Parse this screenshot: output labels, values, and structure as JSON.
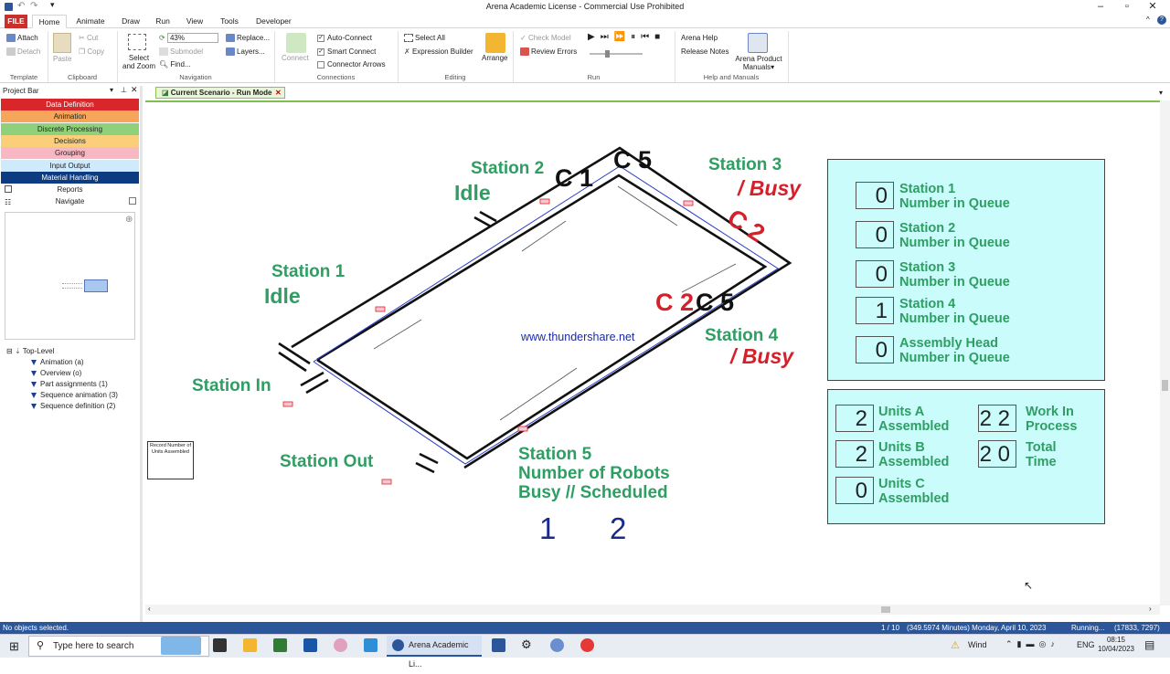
{
  "window": {
    "title": "Arena Academic License - Commercial Use Prohibited"
  },
  "tabs": [
    "FILE",
    "Home",
    "Animate",
    "Draw",
    "Run",
    "View",
    "Tools",
    "Developer"
  ],
  "ribbon": {
    "template": {
      "attach": "Attach",
      "detach": "Detach",
      "label": "Template"
    },
    "clipboard": {
      "paste": "Paste",
      "cut": "Cut",
      "copy": "Copy",
      "label": "Clipboard"
    },
    "navigation": {
      "select_zoom_1": "Select",
      "select_zoom_2": "and Zoom",
      "zoom": "43%",
      "submodel": "Submodel",
      "find": "Find...",
      "replace": "Replace...",
      "layers": "Layers...",
      "label": "Navigation"
    },
    "connections": {
      "connect": "Connect",
      "auto_connect": "Auto-Connect",
      "smart_connect": "Smart Connect",
      "connector_arrows": "Connector Arrows",
      "label": "Connections"
    },
    "editing": {
      "select_all": "Select All",
      "expression_builder": "Expression Builder",
      "arrange": "Arrange",
      "label": "Editing"
    },
    "run": {
      "check_model": "Check Model",
      "review_errors": "Review Errors",
      "label": "Run"
    },
    "help": {
      "arena_help": "Arena Help",
      "release_notes": "Release Notes",
      "product_manuals_1": "Arena Product",
      "product_manuals_2": "Manuals",
      "label": "Help and Manuals"
    }
  },
  "project_bar": {
    "title": "Project Bar",
    "panels": [
      {
        "label": "Data Definition",
        "color": "#d9262b",
        "text": "#ffffff"
      },
      {
        "label": "Animation",
        "color": "#f6a65a",
        "text": "#222222"
      },
      {
        "label": "Discrete Processing",
        "color": "#8fd17a",
        "text": "#222222"
      },
      {
        "label": "Decisions",
        "color": "#fbcf7a",
        "text": "#222222"
      },
      {
        "label": "Grouping",
        "color": "#f7b8c3",
        "text": "#222222"
      },
      {
        "label": "Input Output",
        "color": "#cfeafc",
        "text": "#222222"
      },
      {
        "label": "Material Handling",
        "color": "#0d3b82",
        "text": "#ffffff"
      }
    ],
    "reports": "Reports",
    "navigate": "Navigate",
    "tree": {
      "root": "Top-Level",
      "items": [
        "Animation (a)",
        "Overview (o)",
        "Part assignments (1)",
        "Sequence animation (3)",
        "Sequence definition (2)"
      ]
    }
  },
  "canvas": {
    "tab": "Current Scenario - Run Mode",
    "stations": {
      "station1": "Station 1",
      "station1_status": "Idle",
      "station2": "Station 2",
      "station2_status": "Idle",
      "station3": "Station 3",
      "station3_status": "/ Busy",
      "station4": "Station 4",
      "station4_status": "/ Busy",
      "station_in": "Station In",
      "station_out": "Station Out",
      "station5_line1": "Station 5",
      "station5_line2": "Number of Robots",
      "station5_line3": "Busy // Scheduled",
      "robots_busy": "1",
      "robots_scheduled": "2"
    },
    "robot_tags": [
      "C 1",
      "C 5",
      "C 2",
      "C 2",
      "C 5"
    ],
    "watermark": "www.thundershare.net",
    "record_box": "Record Number of Units Assembled",
    "queue_panel": [
      {
        "value": "0",
        "line1": "Station 1",
        "line2": "Number in Queue"
      },
      {
        "value": "0",
        "line1": "Station 2",
        "line2": "Number in Queue"
      },
      {
        "value": "0",
        "line1": "Station 3",
        "line2": "Number in Queue"
      },
      {
        "value": "1",
        "line1": "Station 4",
        "line2": "Number in Queue"
      },
      {
        "value": "0",
        "line1": "Assembly Head",
        "line2": "Number in Queue"
      }
    ],
    "stats_panel": {
      "units_a": {
        "value": "2",
        "line1": "Units A",
        "line2": "Assembled"
      },
      "units_b": {
        "value": "2",
        "line1": "Units B",
        "line2": "Assembled"
      },
      "units_c": {
        "value": "0",
        "line1": "Units C",
        "line2": "Assembled"
      },
      "wip": {
        "value": "2 2",
        "line1": "Work In",
        "line2": "Process"
      },
      "total_time": {
        "value": "2 0",
        "line1": "Total",
        "line2": "Time"
      }
    }
  },
  "status_bar": {
    "left": "No objects selected.",
    "page": "1 / 10",
    "time": "(349.5974 Minutes) Monday, April 10, 2023",
    "state": "Running...",
    "coords": "(17833, 7297)"
  },
  "taskbar": {
    "search_placeholder": "Type here to search",
    "active_app": "Arena Academic Li...",
    "weather": "Wind",
    "lang": "ENG",
    "time": "08:15",
    "date": "10/04/2023"
  },
  "colors": {
    "green_label": "#2e9e63",
    "busy_red": "#d3202a",
    "panel_cyan": "#cbfcfc",
    "status_blue": "#2b579a"
  }
}
